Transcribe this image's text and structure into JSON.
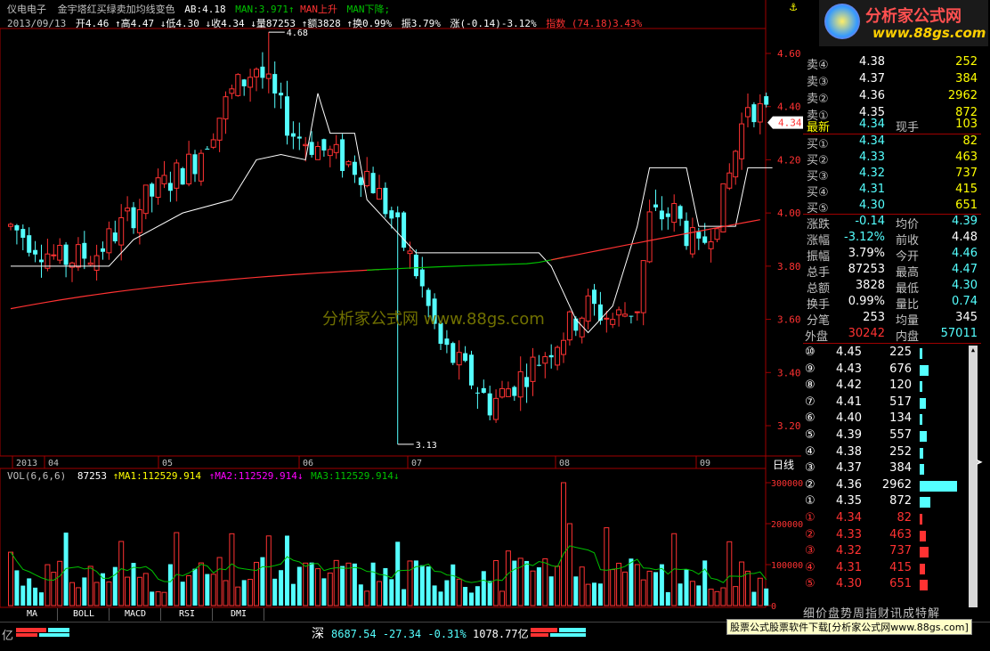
{
  "header": {
    "title": "仪电电子",
    "indicator_name": "金宇塔红买绿卖加均线变色",
    "ab_label": "AB:4.18",
    "man_label": "MAN:3.971↑",
    "man_up": "MAN上升",
    "man_down": "MAN下降;",
    "info_date": "2013/09/13",
    "info_open": "开4.46",
    "info_high": "↑高4.47",
    "info_low": "↓低4.30",
    "info_close": "↓收4.34",
    "info_vol": "↓量87253",
    "info_amount": "↑额3828",
    "info_turnover": "↑换0.99%",
    "info_amp": "振3.79%",
    "info_change": "涨(-0.14)-3.12%",
    "info_index_label": "指数",
    "info_index": "(74.18)3.43%"
  },
  "price_axis": [
    "4.60",
    "4.40",
    "4.20",
    "4.00",
    "3.80",
    "3.60",
    "3.40",
    "3.20"
  ],
  "current_price_tag": "4.34",
  "annotations": {
    "high": "4.68",
    "low": "3.13"
  },
  "watermark": "分析家公式网 www.88gs.com",
  "date_axis": [
    "2013",
    "04",
    "05",
    "06",
    "07",
    "08",
    "09"
  ],
  "period_label": "日线",
  "vol_header": {
    "label": "VOL(6,6,6)",
    "value": "87253",
    "ma1": "MA1:112529.914",
    "ma2": "MA2:112529.914",
    "ma3": "MA3:112529.914"
  },
  "vol_axis": [
    "300000",
    "200000",
    "100000",
    "0"
  ],
  "tabs": [
    "MA",
    "BOLL",
    "MACD",
    "RSI",
    "DMI"
  ],
  "logo": {
    "title": "分析家公式网",
    "url": "www.88gs.com"
  },
  "order_book": {
    "sell": [
      {
        "label": "卖⑤",
        "price": "4.39",
        "vol": "2673"
      },
      {
        "label": "卖④",
        "price": "4.38",
        "vol": "252"
      },
      {
        "label": "卖③",
        "price": "4.37",
        "vol": "384"
      },
      {
        "label": "卖②",
        "price": "4.36",
        "vol": "2962"
      },
      {
        "label": "卖①",
        "price": "4.35",
        "vol": "872"
      }
    ],
    "latest": {
      "label": "最新",
      "price": "4.34",
      "now_label": "现手",
      "now": "103"
    },
    "buy": [
      {
        "label": "买①",
        "price": "4.34",
        "vol": "82"
      },
      {
        "label": "买②",
        "price": "4.33",
        "vol": "463"
      },
      {
        "label": "买③",
        "price": "4.32",
        "vol": "737"
      },
      {
        "label": "买④",
        "price": "4.31",
        "vol": "415"
      },
      {
        "label": "买⑤",
        "price": "4.30",
        "vol": "651"
      }
    ]
  },
  "stats": [
    {
      "l1": "涨跌",
      "v1": "-0.14",
      "l2": "均价",
      "v2": "4.39"
    },
    {
      "l1": "涨幅",
      "v1": "-3.12%",
      "l2": "前收",
      "v2": "4.48"
    },
    {
      "l1": "振幅",
      "v1": "3.79%",
      "l2": "今开",
      "v2": "4.46"
    },
    {
      "l1": "总手",
      "v1": "87253",
      "l2": "最高",
      "v2": "4.47"
    },
    {
      "l1": "总额",
      "v1": "3828",
      "l2": "最低",
      "v2": "4.30"
    },
    {
      "l1": "换手",
      "v1": "0.99%",
      "l2": "量比",
      "v2": "0.74"
    },
    {
      "l1": "分笔",
      "v1": "253",
      "l2": "均量",
      "v2": "345"
    }
  ],
  "outer_inner": {
    "out_label": "外盘",
    "out": "30242",
    "in_label": "内盘",
    "in": "57011"
  },
  "depth": [
    {
      "n": "⑩",
      "price": "4.45",
      "vol": "225",
      "side": "sell",
      "frac": 0.076
    },
    {
      "n": "⑨",
      "price": "4.43",
      "vol": "676",
      "side": "sell",
      "frac": 0.228
    },
    {
      "n": "⑧",
      "price": "4.42",
      "vol": "120",
      "side": "sell",
      "frac": 0.04
    },
    {
      "n": "⑦",
      "price": "4.41",
      "vol": "517",
      "side": "sell",
      "frac": 0.175
    },
    {
      "n": "⑥",
      "price": "4.40",
      "vol": "134",
      "side": "sell",
      "frac": 0.045
    },
    {
      "n": "⑤",
      "price": "4.39",
      "vol": "557",
      "side": "sell",
      "frac": 0.188
    },
    {
      "n": "④",
      "price": "4.38",
      "vol": "252",
      "side": "sell",
      "frac": 0.085
    },
    {
      "n": "③",
      "price": "4.37",
      "vol": "384",
      "side": "sell",
      "frac": 0.13
    },
    {
      "n": "②",
      "price": "4.36",
      "vol": "2962",
      "side": "sell",
      "frac": 1.0
    },
    {
      "n": "①",
      "price": "4.35",
      "vol": "872",
      "side": "sell",
      "frac": 0.294
    },
    {
      "n": "①",
      "price": "4.34",
      "vol": "82",
      "side": "buy",
      "frac": 0.028
    },
    {
      "n": "②",
      "price": "4.33",
      "vol": "463",
      "side": "buy",
      "frac": 0.156
    },
    {
      "n": "③",
      "price": "4.32",
      "vol": "737",
      "side": "buy",
      "frac": 0.249
    },
    {
      "n": "④",
      "price": "4.31",
      "vol": "415",
      "side": "buy",
      "frac": 0.14
    },
    {
      "n": "⑤",
      "price": "4.30",
      "vol": "651",
      "side": "buy",
      "frac": 0.22
    }
  ],
  "bottom_tabs": "细价盘势周指财讯成特解",
  "status": {
    "market": "深",
    "index": "8687.54",
    "change": "-27.34",
    "pct": "-0.31%",
    "amount": "1078.77亿",
    "left_unit": "亿",
    "ad": "股票公式股票软件下载[分析家公式网www.88gs.com]"
  },
  "colors": {
    "up": "#ff3232",
    "down": "#54ffff",
    "white": "#ffffff",
    "green": "#00c000",
    "yellow": "#ffff00",
    "magenta": "#ff00ff"
  }
}
